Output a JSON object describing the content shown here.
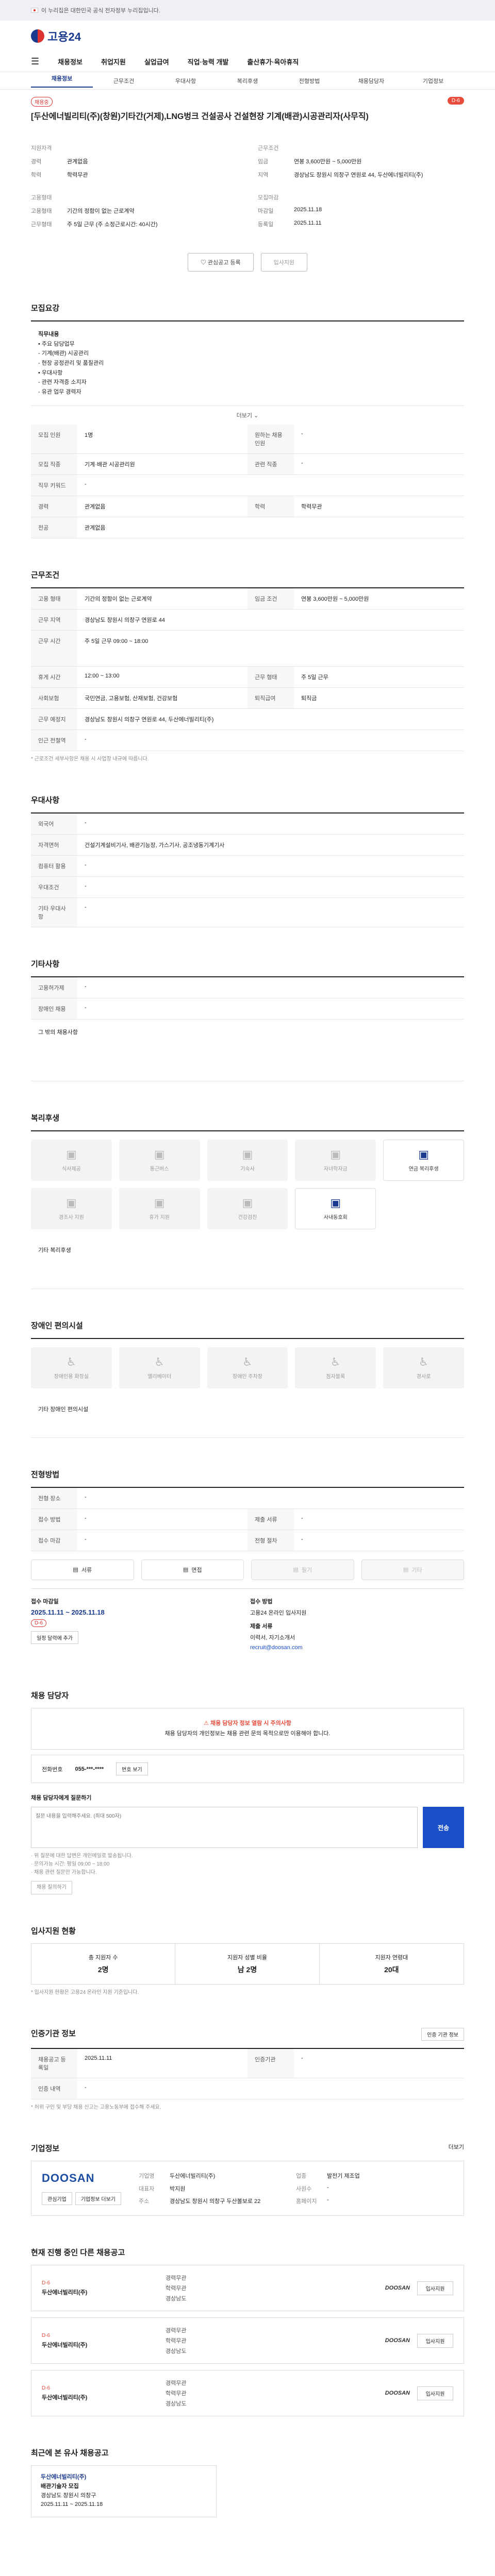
{
  "topbar": {
    "notice": "이 누리집은 대한민국 공식 전자정부 누리집입니다."
  },
  "header": {
    "logo": "고용24"
  },
  "gnb": [
    "채용정보",
    "취업지원",
    "실업급여",
    "직업·능력 개발",
    "출산휴가·육아휴직"
  ],
  "subtabs": [
    "채용정보",
    "근무조건",
    "우대사항",
    "복리후생",
    "전형방법",
    "채용담당자",
    "기업정보"
  ],
  "job": {
    "tag": "채용중",
    "dday": "D-6",
    "title": "[두산에너빌리티(주)(창원)기타간(거제),LNG벙크 건설공사 건설현장 기계(배관)시공관리자(사무직)",
    "summary": [
      {
        "head": "지원자격",
        "rows": [
          [
            "경력",
            "관계없음"
          ],
          [
            "학력",
            "학력무관"
          ]
        ]
      },
      {
        "head": "근무조건",
        "rows": [
          [
            "임금",
            "연봉 3,600만원 ~ 5,000만원"
          ],
          [
            "지역",
            "경상남도 창원시 의창구 연원로 44, 두산에너빌리티(주)"
          ]
        ]
      },
      {
        "head": "고용형태",
        "rows": [
          [
            "고용형태",
            "기간의 정함이 없는 근로계약"
          ],
          [
            "근무형태",
            "주 5일 근무 (주 소정근로시간: 40시간)"
          ]
        ]
      },
      {
        "head": "모집마감",
        "rows": [
          [
            "마감일",
            "2025.11.18"
          ],
          [
            "등록일",
            "2025.11.11"
          ]
        ]
      }
    ]
  },
  "buttons": {
    "scrap": "관심공고 등록",
    "apply": "입사지원"
  },
  "recruit": {
    "title": "모집요강",
    "desc_head": "직무내용",
    "desc_lines": [
      "• 주요 담당업무",
      " - 기계(배관) 시공관리",
      " - 현장 공정관리 및 품질관리",
      "• 우대사항",
      " - 관련 자격증 소지자",
      " - 유관 업무 경력자"
    ],
    "more": "더보기",
    "rows": [
      [
        "모집 인원",
        "1명",
        "원하는 채용 인원",
        "-"
      ],
      [
        "모집 직종",
        "기계·배관 시공관리원",
        "관련 직종",
        "-"
      ],
      [
        "직무 키워드",
        "-",
        "",
        ""
      ],
      [
        "경력",
        "관계없음",
        "학력",
        "학력무관"
      ],
      [
        "전공",
        "관계없음",
        "",
        ""
      ]
    ]
  },
  "work": {
    "title": "근무조건",
    "rows": [
      [
        "고용 형태",
        "기간의 정함이 없는 근로계약",
        "임금 조건",
        "연봉 3,600만원 ~ 5,000만원"
      ],
      [
        "근무 지역",
        "경상남도 창원시 의창구 연원로 44",
        "",
        ""
      ],
      [
        "근무 시간",
        "주 5일 근무 09:00 ~ 18:00",
        "",
        ""
      ],
      [
        "휴게 시간",
        "12:00 ~ 13:00",
        "근무 형태",
        "주 5일 근무"
      ],
      [
        "사회보험",
        "국민연금, 고용보험, 산재보험, 건강보험",
        "퇴직급여",
        "퇴직금"
      ],
      [
        "근무 예정지",
        "경상남도 창원시 의창구 연원로 44, 두산에너빌리티(주)",
        "",
        ""
      ],
      [
        "인근 전철역",
        "-",
        "",
        ""
      ]
    ],
    "note": "* 근로조건 세부사항은 채용 시 사업장 내규에 따릅니다."
  },
  "pref": {
    "title": "우대사항",
    "rows": [
      [
        "외국어",
        "-"
      ],
      [
        "자격면허",
        "건설기계설비기사, 배관기능장, 가스기사, 공조냉동기계기사"
      ],
      [
        "컴퓨터 활용",
        "-"
      ],
      [
        "우대조건",
        "-"
      ],
      [
        "기타 우대사항",
        "-"
      ]
    ]
  },
  "etc": {
    "title": "기타사항",
    "rows": [
      [
        "고용허가제",
        "-"
      ],
      [
        "장애인 채용",
        "-"
      ]
    ],
    "desc": "그 밖의 채용사항"
  },
  "welfare": {
    "title": "복리후생",
    "items": [
      {
        "label": "식사제공",
        "on": false
      },
      {
        "label": "통근버스",
        "on": false
      },
      {
        "label": "기숙사",
        "on": false
      },
      {
        "label": "자녀학자금",
        "on": false
      },
      {
        "label": "연금 복리후생",
        "on": true
      },
      {
        "label": "경조사 지원",
        "on": false
      },
      {
        "label": "휴가 지원",
        "on": false
      },
      {
        "label": "건강검진",
        "on": false
      },
      {
        "label": "사내동호회",
        "on": true
      }
    ],
    "extra": "기타 복리후생"
  },
  "disabled": {
    "title": "장애인 편의시설",
    "items": [
      "장애인용 화장실",
      "엘리베이터",
      "장애인 주차장",
      "점자블록",
      "경사로"
    ],
    "note": "기타 장애인 편의시설"
  },
  "selection": {
    "title": "전형방법",
    "rows": [
      [
        "전형 장소",
        "-"
      ],
      [
        "접수 방법",
        "-",
        "제출 서류",
        "-"
      ],
      [
        "접수 마감",
        "-",
        "전형 절차",
        "-"
      ]
    ],
    "methods": [
      {
        "label": "서류",
        "on": true
      },
      {
        "label": "면접",
        "on": true
      },
      {
        "label": "필기",
        "on": false
      },
      {
        "label": "기타",
        "on": false
      }
    ],
    "period_label": "접수 마감일",
    "period_value": "2025.11.11 ~ 2025.11.18",
    "dday": "D-6",
    "deadline_label": "접수 방법",
    "deadline_value": "고용24 온라인 입사지원",
    "docs_label": "제출 서류",
    "docs_value": "이력서, 자기소개서",
    "email": "recruit@doosan.com",
    "calendar": "일정 달력에 추가"
  },
  "contact": {
    "title": "채용 담당자",
    "warn": "⚠ 채용 담당자 정보 열람 시 주의사항",
    "text": "채용 담당자의 개인정보는 채용 관련 문의 목적으로만 이용해야 합니다.",
    "phone_label": "전화번호",
    "phone": "055-***-****",
    "view": "번호 보기",
    "inquiry_title": "채용 담당자에게 질문하기",
    "inquiry_placeholder": "질문 내용을 입력해주세요. (최대 500자)",
    "send": "전송",
    "notes": [
      "· 위 질문에 대한 답변은 개인메일로 발송됩니다.",
      "· 문의가능 시간: 평일 09:00 ~ 18:00",
      "· 채용 관련 질문만 가능합니다."
    ],
    "notes_btn": "채용 질의하기"
  },
  "stats": {
    "title": "입사지원 현황",
    "items": [
      {
        "label": "총 지원자 수",
        "value": "2명"
      },
      {
        "label": "지원자 성별 비율",
        "value": "남 2명"
      },
      {
        "label": "지원자 연령대",
        "value": "20대"
      }
    ],
    "note": "* 입사지원 현황은 고용24 온라인 지원 기준입니다."
  },
  "info": {
    "title": "인증기관 정보",
    "btn": "인증 기관 정보",
    "rows": [
      [
        "채용공고 등록일",
        "2025.11.11",
        "인증기관",
        "-"
      ],
      [
        "인증 내역",
        "-",
        "",
        ""
      ]
    ],
    "note": "* 허위 구인 및 부당 채용 신고는 고용노동부에 접수해 주세요."
  },
  "company": {
    "title": "기업정보",
    "more": "더보기",
    "logo": "DOOSAN",
    "rows": [
      [
        "기업명",
        "두산에너빌리티(주)",
        "업종",
        "발전기 제조업"
      ],
      [
        "대표자",
        "박지원",
        "사원수",
        "-"
      ],
      [
        "주소",
        "경상남도 창원시 의창구 두산볼보로 22",
        "홈페이지",
        "-"
      ]
    ],
    "btns": [
      "관심기업",
      "기업정보 더보기"
    ]
  },
  "sameJobs": {
    "title": "현재 진행 중인 다른 채용공고",
    "items": [
      {
        "dday": "D-6",
        "name": "두산에너빌리티(주)",
        "lines": [
          "경력무관",
          "학력무관",
          "경상남도"
        ],
        "brand": "DOOSAN",
        "apply": "입사지원"
      },
      {
        "dday": "D-6",
        "name": "두산에너빌리티(주)",
        "lines": [
          "경력무관",
          "학력무관",
          "경상남도"
        ],
        "brand": "DOOSAN",
        "apply": "입사지원"
      },
      {
        "dday": "D-6",
        "name": "두산에너빌리티(주)",
        "lines": [
          "경력무관",
          "학력무관",
          "경상남도"
        ],
        "brand": "DOOSAN",
        "apply": "입사지원"
      }
    ]
  },
  "recent": {
    "title": "최근에 본 유사 채용공고",
    "company": "두산에너빌리티(주)",
    "job": "배관기술자 모집",
    "desc": "경상남도 창원시 의창구",
    "date": "2025.11.11 ~ 2025.11.18"
  }
}
